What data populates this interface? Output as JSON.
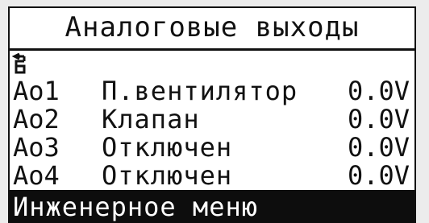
{
  "screen": {
    "title": "Аналоговые выходы",
    "back_icon": "return-arrow-icon"
  },
  "outputs": [
    {
      "code": "Ao1",
      "name": "П.вентилятор",
      "value": "0.0V"
    },
    {
      "code": "Ao2",
      "name": "Клапан",
      "value": "0.0V"
    },
    {
      "code": "Ao3",
      "name": "Отключен",
      "value": "0.0V"
    },
    {
      "code": "Ao4",
      "name": "Отключен",
      "value": "0.0V"
    }
  ],
  "footer": {
    "menu_label": "Инженерное меню"
  },
  "colors": {
    "background": "#ffffff",
    "foreground": "#111111",
    "selection": "#0d0d0d",
    "selection_text": "#ffffff"
  }
}
